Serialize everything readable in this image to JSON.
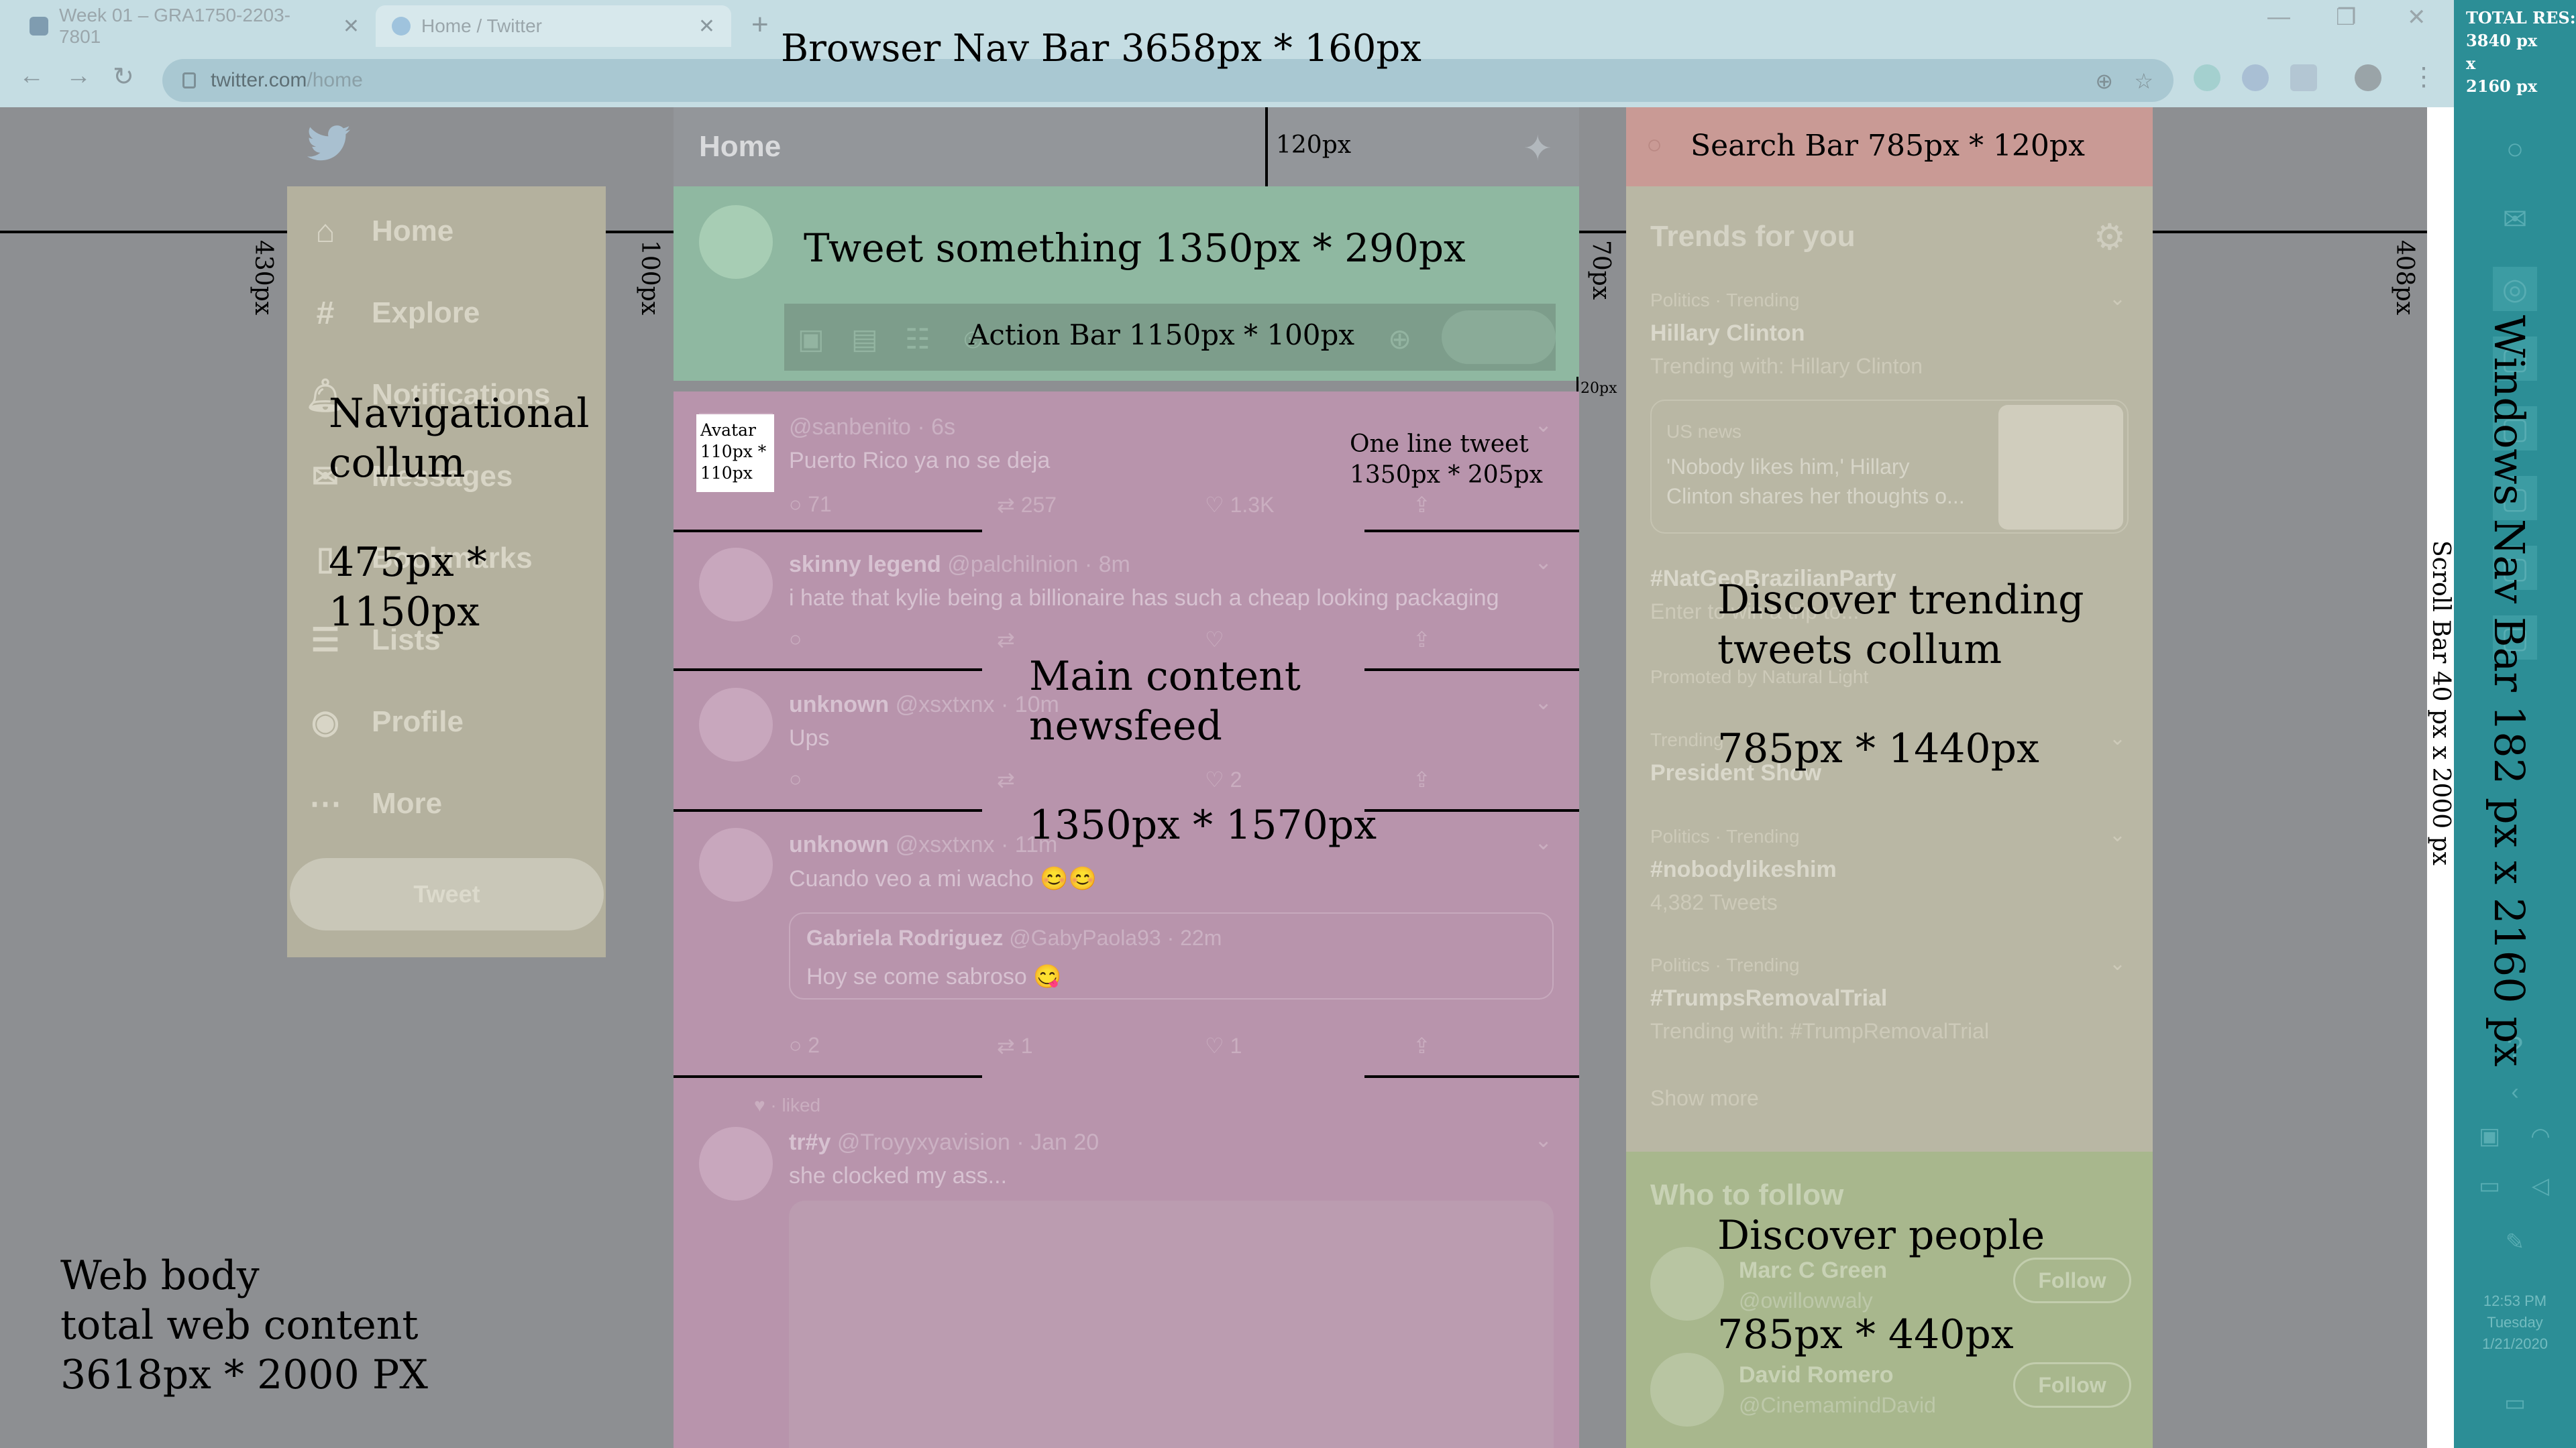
{
  "browser": {
    "tabs": [
      {
        "title": "Week 01 – GRA1750-2203-7801",
        "close": "✕"
      },
      {
        "title": "Home / Twitter",
        "close": "✕"
      }
    ],
    "new_tab": "+",
    "window_controls": [
      "—",
      "❐",
      "✕"
    ],
    "url_host": "twitter.com",
    "url_path": "/home"
  },
  "twitter": {
    "nav_items": [
      {
        "label": "Home",
        "icon": "home-icon"
      },
      {
        "label": "Explore",
        "icon": "hash-icon",
        "glyph": "#"
      },
      {
        "label": "Notifications",
        "icon": "bell-icon"
      },
      {
        "label": "Messages",
        "icon": "mail-icon"
      },
      {
        "label": "Bookmarks",
        "icon": "bookmark-icon"
      },
      {
        "label": "Lists",
        "icon": "list-icon"
      },
      {
        "label": "Profile",
        "icon": "profile-icon"
      },
      {
        "label": "More",
        "icon": "more-icon",
        "glyph": "⋯"
      }
    ],
    "tweet_button": "Tweet",
    "header_title": "Home",
    "tweets": [
      {
        "name": "",
        "handle": "@sanbenito · 6s",
        "text": "Puerto Rico ya no se deja",
        "replies": "71",
        "retweets": "257",
        "likes": "1.3K"
      },
      {
        "name": "skinny legend",
        "handle": "@palchilnion · 8m",
        "text": "i hate that kylie being a billionaire has such a cheap looking packaging"
      },
      {
        "name": "unknown",
        "handle": "@xsxtxnx · 10m",
        "text": "Ups",
        "likes": "2"
      },
      {
        "name": "unknown",
        "handle": "@xsxtxnx · 11m",
        "text": "Cuando veo a mi wacho 😊😊",
        "replies": "2",
        "retweets": "1",
        "likes": "1",
        "quote": {
          "name": "Gabriela Rodriguez",
          "handle": "@GabyPaola93 · 22m",
          "text": "Hoy se come sabroso 😋"
        }
      },
      {
        "liked": "· liked",
        "name": "tr#y",
        "handle": "@Troyyxyavision · Jan 20",
        "text": "she clocked my ass..."
      }
    ],
    "trending": {
      "title": "Trends for you",
      "items": [
        {
          "meta": "Politics · Trending",
          "name": "Hillary Clinton",
          "sub": "Trending with: Hillary Clinton"
        },
        {
          "meta": "",
          "name": "#NatGeoBrazilianParty",
          "sub": "Enter to win a trip to...",
          "promoted": "Promoted by Natural Light"
        },
        {
          "meta": "Trending",
          "name": "President Show",
          "sub": ""
        },
        {
          "meta": "Politics · Trending",
          "name": "#nobodylikeshim",
          "sub": "4,382 Tweets"
        },
        {
          "meta": "Politics · Trending",
          "name": "#TrumpsRemovalTrial",
          "sub": "Trending with: #TrumpRemovalTrial"
        }
      ],
      "news": {
        "source": "US news",
        "headline_1": "'Nobody likes him,' Hillary",
        "headline_2": "Clinton shares her thoughts o..."
      },
      "show_more": "Show more"
    },
    "who_to_follow": {
      "title": "Who to follow",
      "people": [
        {
          "name": "Marc C Green",
          "handle": "@owillowwaly",
          "button": "Follow"
        },
        {
          "name": "David Romero",
          "handle": "@CinemamindDavid",
          "button": "Follow"
        }
      ]
    }
  },
  "taskbar": {
    "clock_time": "12:53 PM",
    "clock_day": "Tuesday",
    "clock_date": "1/21/2020"
  },
  "annotations": {
    "browser_nav": "Browser Nav Bar  3658px * 160px",
    "total_res": [
      "TOTAL RES:",
      "3840 px",
      "x",
      "2160 px"
    ],
    "search_bar": "Search Bar 785px * 120px",
    "dim_120": "120px",
    "tweet_something": "Tweet something 1350px * 290px",
    "action_bar": "Action Bar 1150px * 100px",
    "dim_430": "430px",
    "dim_100": "100px",
    "dim_70": "70px",
    "dim_408": "408px",
    "dim_20": "20px",
    "nav_column": [
      "Navigational",
      "collum",
      "",
      "475px *",
      "1150px"
    ],
    "avatar": [
      "Avatar",
      "110px *",
      "110px"
    ],
    "one_line_tweet": [
      "One line tweet",
      "1350px * 205px"
    ],
    "main_content": [
      "Main content",
      "newsfeed",
      "",
      "1350px * 1570px"
    ],
    "discover_trending": [
      "Discover trending",
      "tweets collum",
      "",
      "785px * 1440px"
    ],
    "scroll_bar": "Scroll Bar  40 px x 2000 px",
    "windows_nav": "Windows Nav Bar  182 px x 2160 px",
    "discover_people": [
      "Discover people",
      "",
      "785px *  440px"
    ],
    "web_body": [
      "Web body",
      "total web content",
      "3618px * 2000 PX"
    ]
  }
}
